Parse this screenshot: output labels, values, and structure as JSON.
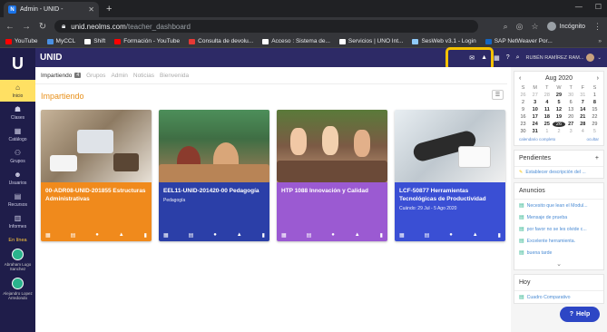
{
  "browser": {
    "tab_title": "Admin - UNID -",
    "tab_fav": "N",
    "new_tab": "+",
    "url_host": "unid.neolms.com",
    "url_path": "/teacher_dashboard",
    "incognito": "Incógnito",
    "bookmarks": [
      {
        "label": "YouTube",
        "color": "#ff0000"
      },
      {
        "label": "MyCCL",
        "color": "#4a90e2"
      },
      {
        "label": "Shift",
        "color": "#ffffff"
      },
      {
        "label": "Formación - YouTube",
        "color": "#ff0000"
      },
      {
        "label": "Consulta de devolu...",
        "color": "#e53935"
      },
      {
        "label": "Acceso : Sistema de...",
        "color": "#ffffff"
      },
      {
        "label": "Servicios | UNO Int...",
        "color": "#ffffff"
      },
      {
        "label": "SesWeb v3.1 - Login",
        "color": "#90caf9"
      },
      {
        "label": "SAP NetWeaver Por...",
        "color": "#1565c0"
      }
    ],
    "bookmarks_more": "»"
  },
  "app": {
    "brand": "UNID",
    "user_name": "RUBÉN RAMÍREZ RAM...",
    "sidebar": [
      {
        "label": "Inicio",
        "icon": "⌂"
      },
      {
        "label": "Clases",
        "icon": "☗"
      },
      {
        "label": "Catálogo",
        "icon": "▦"
      },
      {
        "label": "Grupos",
        "icon": "⚇"
      },
      {
        "label": "Usuarios",
        "icon": "☻"
      },
      {
        "label": "Recursos",
        "icon": "▤"
      },
      {
        "label": "Informes",
        "icon": "▥"
      }
    ],
    "online_label": "En línea",
    "people": [
      {
        "name": "Abraham Lugo Sanchez"
      },
      {
        "name": "Alejandro Lopez Arredondo"
      }
    ],
    "subnav": {
      "active": "Impartiendo",
      "active_badge": "4",
      "others": [
        "Grupos",
        "Admin",
        "Noticias",
        "Bienvenida"
      ]
    },
    "section_title": "Impartiendo",
    "cards": [
      {
        "title": "00-ADR08-UNID-201855 Estructuras Administrativas",
        "sub": ""
      },
      {
        "title": "EEL11-UNID-201420-00 Pedagogía",
        "sub": "Pedagogía"
      },
      {
        "title": "HTP 1088 Innovación y Calidad",
        "sub": ""
      },
      {
        "title": "LCF-50877 Herramientas Tecnológicas de Productividad",
        "sub": "Cuándo: 29 Jul - 5 Ago 2020"
      }
    ],
    "calendar": {
      "month": "Aug 2020",
      "day_names": [
        "S",
        "M",
        "T",
        "W",
        "T",
        "F",
        "S"
      ],
      "rows": [
        [
          [
            "26",
            "mut"
          ],
          [
            "27",
            "mut"
          ],
          [
            "28",
            "mut"
          ],
          [
            "29",
            "b"
          ],
          [
            "30",
            "mut"
          ],
          [
            "31",
            "mut"
          ],
          [
            "1",
            ""
          ]
        ],
        [
          [
            "2",
            ""
          ],
          [
            "3",
            "b"
          ],
          [
            "4",
            "b"
          ],
          [
            "5",
            "b"
          ],
          [
            "6",
            ""
          ],
          [
            "7",
            "b"
          ],
          [
            "8",
            "b"
          ]
        ],
        [
          [
            "9",
            ""
          ],
          [
            "10",
            "b"
          ],
          [
            "11",
            "b"
          ],
          [
            "12",
            "b"
          ],
          [
            "13",
            ""
          ],
          [
            "14",
            "b"
          ],
          [
            "15",
            ""
          ]
        ],
        [
          [
            "16",
            ""
          ],
          [
            "17",
            "b"
          ],
          [
            "18",
            "b"
          ],
          [
            "19",
            "b"
          ],
          [
            "20",
            ""
          ],
          [
            "21",
            "b"
          ],
          [
            "22",
            ""
          ]
        ],
        [
          [
            "23",
            ""
          ],
          [
            "24",
            "b"
          ],
          [
            "25",
            "b"
          ],
          [
            "26",
            "today"
          ],
          [
            "27",
            "b"
          ],
          [
            "28",
            "b"
          ],
          [
            "29",
            ""
          ]
        ],
        [
          [
            "30",
            ""
          ],
          [
            "31",
            "b"
          ],
          [
            "1",
            "mut"
          ],
          [
            "2",
            "mut"
          ],
          [
            "3",
            "mut"
          ],
          [
            "4",
            "mut"
          ],
          [
            "5",
            "mut"
          ]
        ]
      ],
      "full_link": "calendario completo",
      "hide_link": "ocultar"
    },
    "pending": {
      "title": "Pendientes",
      "add": "+",
      "items": [
        "Establecer descripción del ..."
      ]
    },
    "announcements": {
      "title": "Anuncios",
      "items": [
        "Necesito que lean el Modul...",
        "Mensaje de prueba",
        "por favor no se les olvide c...",
        "Excelente herramienta.",
        "buena tarde"
      ]
    },
    "today": {
      "title": "Hoy",
      "items": [
        "Cuadro Comparativo"
      ]
    },
    "help_label": "Help"
  }
}
